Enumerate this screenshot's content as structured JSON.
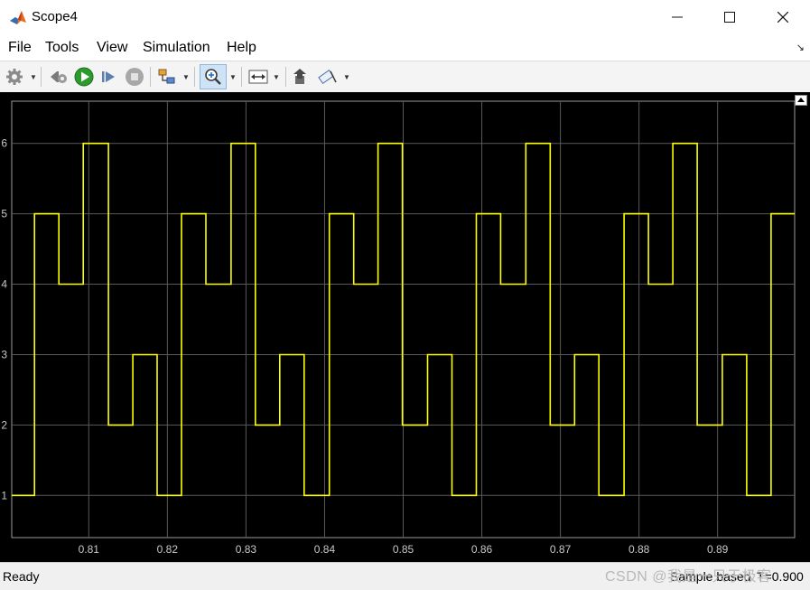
{
  "window": {
    "title": "Scope4",
    "minimize": "—",
    "maximize": "☐",
    "close": "✕"
  },
  "menu": {
    "items": [
      "File",
      "Tools",
      "View",
      "Simulation",
      "Help"
    ],
    "overflow": "↘"
  },
  "toolbar": {
    "buttons": [
      "settings-icon",
      "step-back-icon",
      "run-icon",
      "step-forward-icon",
      "stop-icon",
      "highlight-block-icon",
      "zoom-in-icon",
      "fit-axes-icon",
      "write-data-icon",
      "measurement-icon"
    ],
    "accent_run": "#2c9a2c"
  },
  "chart_data": {
    "type": "line",
    "title": "",
    "xlabel": "",
    "ylabel": "",
    "xlim": [
      0.8002,
      0.8998
    ],
    "ylim": [
      0.4,
      6.6
    ],
    "xticks": [
      0.81,
      0.82,
      0.83,
      0.84,
      0.85,
      0.86,
      0.87,
      0.88,
      0.89
    ],
    "xtick_labels": [
      "0.81",
      "0.82",
      "0.83",
      "0.84",
      "0.85",
      "0.86",
      "0.87",
      "0.88",
      "0.89"
    ],
    "yticks": [
      1,
      2,
      3,
      4,
      5,
      6
    ],
    "ytick_labels": [
      "1",
      "2",
      "3",
      "4",
      "5",
      "6"
    ],
    "grid": true,
    "background": "#000000",
    "grid_color": "#5a5a5a",
    "line_color": "#ffff00",
    "step": "post",
    "series": [
      {
        "x": [
          0.8002,
          0.8031,
          0.8062,
          0.8093,
          0.8125,
          0.8156,
          0.8187,
          0.8218,
          0.8249,
          0.8281,
          0.8312,
          0.8343,
          0.8374,
          0.8406,
          0.8437,
          0.8468,
          0.8499,
          0.8531,
          0.8562,
          0.8593,
          0.8624,
          0.8656,
          0.8687,
          0.8718,
          0.8749,
          0.8781,
          0.8812,
          0.8843,
          0.8874,
          0.8906,
          0.8937,
          0.8968,
          0.8998
        ],
        "values": [
          1,
          5,
          4,
          6,
          2,
          3,
          1,
          5,
          4,
          6,
          2,
          3,
          1,
          5,
          4,
          6,
          2,
          3,
          1,
          5,
          4,
          6,
          2,
          3,
          1,
          5,
          4,
          6,
          2,
          3,
          1,
          5,
          5
        ]
      }
    ]
  },
  "status": {
    "left": "Ready",
    "mode": "Sample based",
    "time_label": "T=0.900"
  },
  "watermark": "CSDN @我是一只于极客"
}
